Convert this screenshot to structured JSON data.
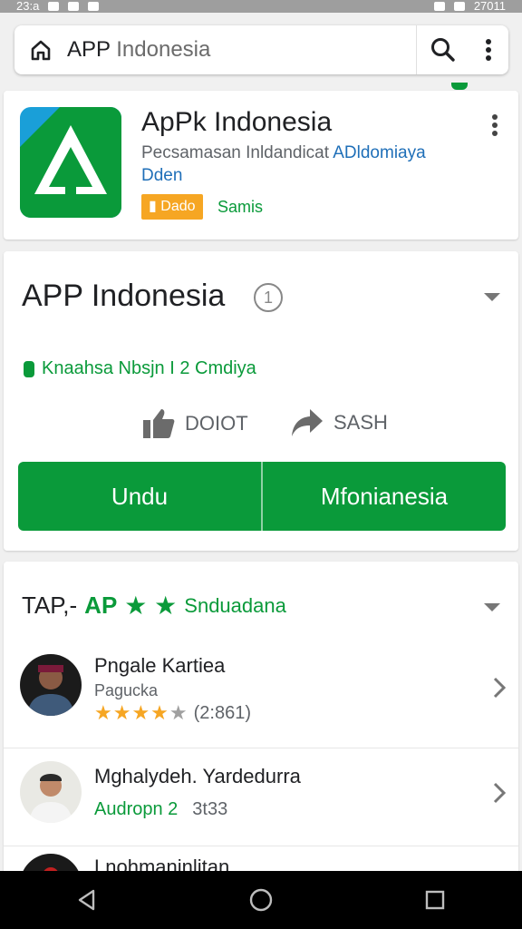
{
  "status_bar": {
    "left": "23:a",
    "right": "27011"
  },
  "url_bar": {
    "prefix": "APP",
    "domain": "Indonesia"
  },
  "app_card": {
    "title": "ApPk Indonesia",
    "description_plain": "Pecsamasan Inldandicat ",
    "description_highlight": "ADldomiaya",
    "description_line2": "Dden",
    "badge": "Dado",
    "badge_label": "Samis"
  },
  "main_card": {
    "title": "APP Indonesia",
    "info_glyph": "1",
    "status_text": "Knaahsa Nbsjn I 2 Cmdiya",
    "like_label": "DOIOT",
    "share_label": "SASH",
    "buttons": [
      "Undu",
      "Mfonianesia"
    ]
  },
  "list_card": {
    "head_prefix": "TAP,-",
    "head_ap": "AP",
    "head_stars": "★ ★",
    "head_label": "Snduadana",
    "items": [
      {
        "name": "Pngale Kartiea",
        "sub": "Pagucka",
        "stars_on": "★★★★",
        "stars_off": "★",
        "count": "(2:861)"
      },
      {
        "name": "Mghalydeh. Yardedurra",
        "meta_a": "Audropn 2",
        "meta_b": "3t33"
      },
      {
        "name": "Lnohmaninlitan"
      }
    ]
  },
  "colors": {
    "accent": "#0a9a3a",
    "badge": "#f6a623",
    "link": "#1f6fb8"
  }
}
